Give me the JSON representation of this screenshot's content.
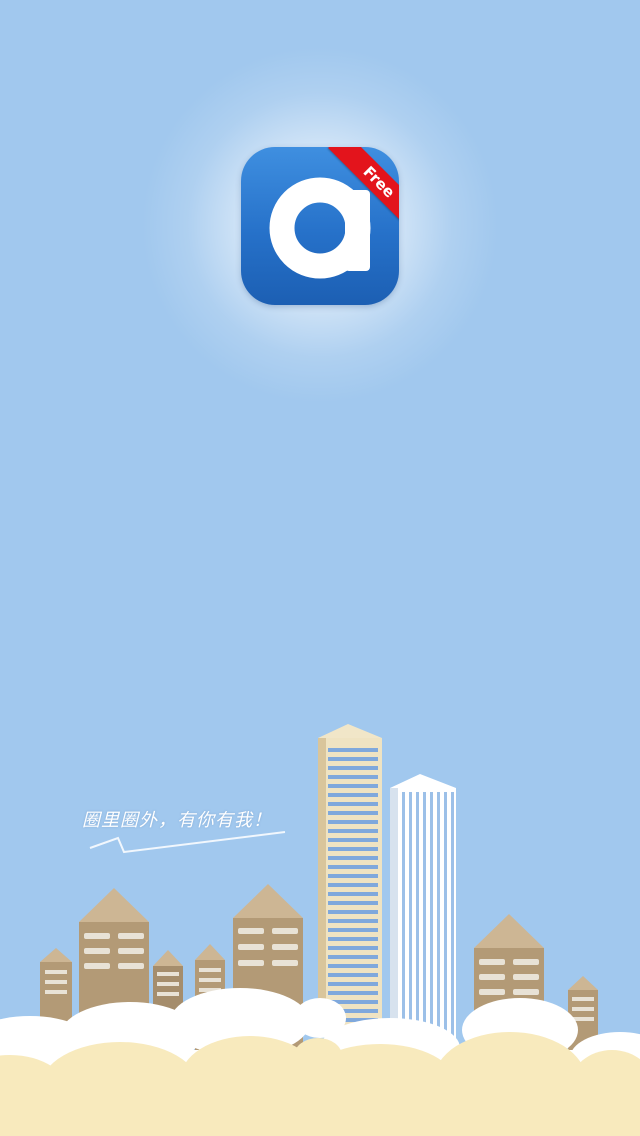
{
  "app_icon": {
    "icon": "app-logo-a-icon",
    "badge": "Free"
  },
  "slogan": "圈里圈外，有你有我！",
  "colors": {
    "sky": "#a1c8ee",
    "icon_blue": "#2671c9",
    "ribbon_red": "#e3141c",
    "building_tan": "#b39a76",
    "cloud_yellow": "#f8eabd"
  }
}
